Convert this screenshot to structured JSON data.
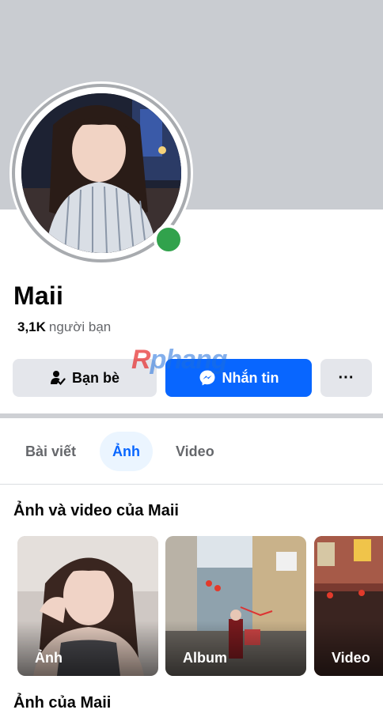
{
  "profile": {
    "name": "Maii",
    "friends_count": "3,1K",
    "friends_label": "người bạn",
    "online": true
  },
  "actions": {
    "friends_label": "Bạn bè",
    "message_label": "Nhắn tin",
    "more_label": "···"
  },
  "watermark": {
    "prefix": "R",
    "rest": "phang"
  },
  "tabs": [
    {
      "label": "Bài viết",
      "active": false
    },
    {
      "label": "Ảnh",
      "active": true
    },
    {
      "label": "Video",
      "active": false
    }
  ],
  "media_section": {
    "title": "Ảnh và video của Maii",
    "cards": [
      {
        "label": "Ảnh"
      },
      {
        "label": "Album"
      },
      {
        "label": "Video"
      }
    ]
  },
  "photos_section": {
    "title": "Ảnh của Maii"
  },
  "colors": {
    "cover": "#c9ccd1",
    "primary": "#0866ff",
    "online": "#31a24c",
    "button_gray": "#e4e6eb"
  },
  "icons": {
    "friends_button": "person-check-icon",
    "message_button": "messenger-icon",
    "more_button": "more-dots-icon"
  }
}
